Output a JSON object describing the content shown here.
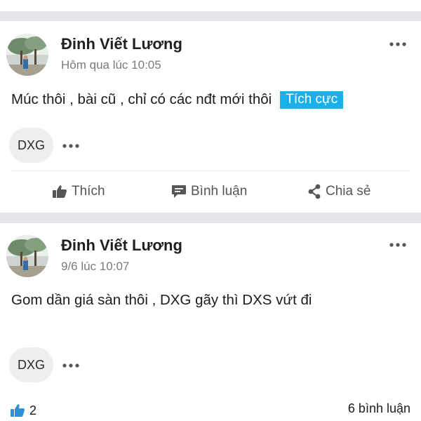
{
  "posts": [
    {
      "author": "Đinh Viết Lương",
      "time": "Hôm qua lúc 10:05",
      "content": "Múc thôi , bài cũ , chỉ có các nđt mới thôi",
      "sentiment": "Tích cực",
      "ticker": "DXG",
      "actions": {
        "like": "Thích",
        "comment": "Bình luận",
        "share": "Chia sẻ"
      }
    },
    {
      "author": "Đinh Viết Lương",
      "time": "9/6 lúc 10:07",
      "content": "Gom dần giá sàn thôi , DXG gãy thì DXS vứt đi",
      "ticker": "DXG",
      "like_count": "2",
      "comment_count": "6 bình luận"
    }
  ],
  "colors": {
    "sentiment_bg": "#1ab0e8",
    "like_blue": "#2f8fd6",
    "separator": "#e4e5e8"
  },
  "icons": {
    "more": "more-horizontal-icon",
    "like": "thumbs-up-icon",
    "comment": "comment-icon",
    "share": "share-icon"
  }
}
